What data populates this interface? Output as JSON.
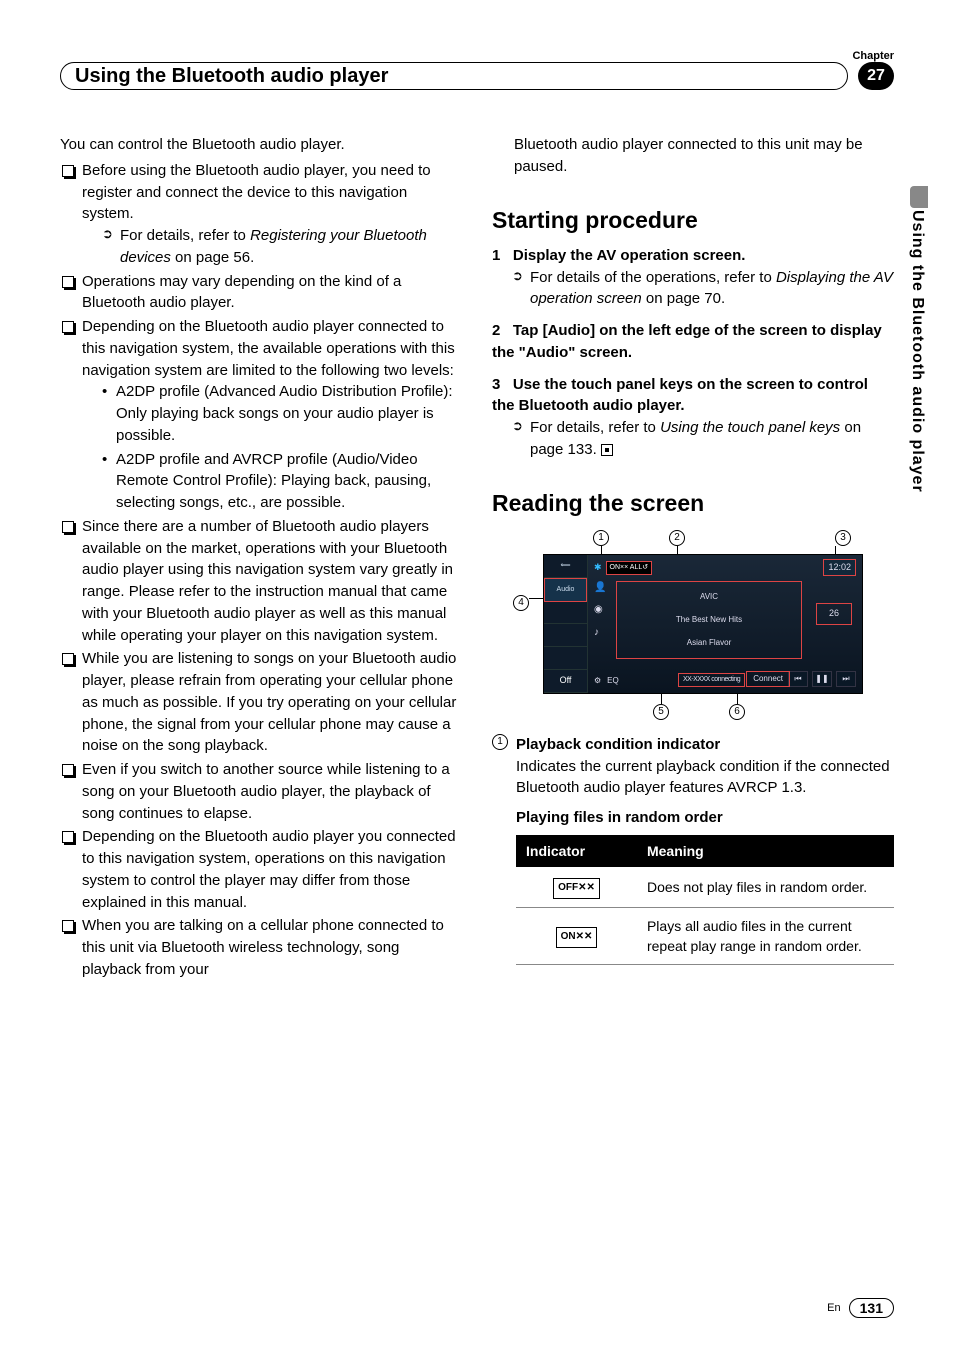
{
  "header": {
    "chapter_label": "Chapter",
    "chapter_number": "27",
    "title": "Using the Bluetooth audio player"
  },
  "side_tab": "Using the Bluetooth audio player",
  "left": {
    "intro": "You can control the Bluetooth audio player.",
    "bullets": [
      {
        "text": "Before using the Bluetooth audio player, you need to register and connect the device to this navigation system.",
        "sub_arrow_prefix": "For details, refer to ",
        "sub_arrow_ref": "Registering your Bluetooth devices",
        "sub_arrow_suffix": " on page 56."
      },
      {
        "text": "Operations may vary depending on the kind of a Bluetooth audio player."
      },
      {
        "text": "Depending on the Bluetooth audio player connected to this navigation system, the available operations with this navigation system are limited to the following two levels:",
        "dashes": [
          "A2DP profile (Advanced Audio Distribution Profile): Only playing back songs on your audio player is possible.",
          "A2DP profile and AVRCP profile (Audio/Video Remote Control Profile): Playing back, pausing, selecting songs, etc., are possible."
        ]
      },
      {
        "text": "Since there are a number of Bluetooth audio players available on the market, operations with your Bluetooth audio player using this navigation system vary greatly in range. Please refer to the instruction manual that came with your Bluetooth audio player as well as this manual while operating your player on this navigation system."
      },
      {
        "text": "While you are listening to songs on your Bluetooth audio player, please refrain from operating your cellular phone as much as possible. If you try operating on your cellular phone, the signal from your cellular phone may cause a noise on the song playback."
      },
      {
        "text": "Even if you switch to another source while listening to a song on your Bluetooth audio player, the playback of song continues to elapse."
      },
      {
        "text": "Depending on the Bluetooth audio player you connected to this navigation system, operations on this navigation system to control the player may differ from those explained in this manual."
      },
      {
        "text": "When you are talking on a cellular phone connected to this unit via Bluetooth wireless technology, song playback from your"
      }
    ]
  },
  "right": {
    "continuation": "Bluetooth audio player connected to this unit may be paused.",
    "starting_heading": "Starting procedure",
    "steps": [
      {
        "num": "1",
        "head": "Display the AV operation screen.",
        "arrow_prefix": "For details of the operations, refer to ",
        "arrow_ref": "Displaying the AV operation screen",
        "arrow_suffix": " on page 70."
      },
      {
        "num": "2",
        "head": "Tap [Audio] on the left edge of the screen to display the \"Audio\" screen."
      },
      {
        "num": "3",
        "head": "Use the touch panel keys on the screen to control the Bluetooth audio player.",
        "arrow_prefix": "For details, refer to ",
        "arrow_ref": "Using the touch panel keys",
        "arrow_suffix": " on page 133."
      }
    ],
    "reading_heading": "Reading the screen",
    "screen": {
      "indicator_text": "ON×× ALL↺",
      "time": "12:02",
      "tab_audio": "Audio",
      "tab_off": "Off",
      "line1": "AVIC",
      "line2": "The Best New Hits",
      "line3": "Asian Flavor",
      "track_num": "26",
      "eq": "EQ",
      "connect": "Connect",
      "conn_text": "XX-XXXX connecting"
    },
    "callouts": {
      "c1": "1",
      "c2": "2",
      "c3": "3",
      "c4": "4",
      "c5": "5",
      "c6": "6"
    },
    "item1_num": "1",
    "item1_title": "Playback condition indicator",
    "item1_body": "Indicates the current playback condition if the connected Bluetooth audio player features AVRCP 1.3.",
    "table_title": "Playing files in random order",
    "th1": "Indicator",
    "th2": "Meaning",
    "row1_icon": "OFF✕✕",
    "row1_text": "Does not play files in random order.",
    "row2_icon": "ON✕✕",
    "row2_text": "Plays all audio files in the current repeat play range in random order."
  },
  "footer": {
    "lang": "En",
    "page": "131"
  }
}
